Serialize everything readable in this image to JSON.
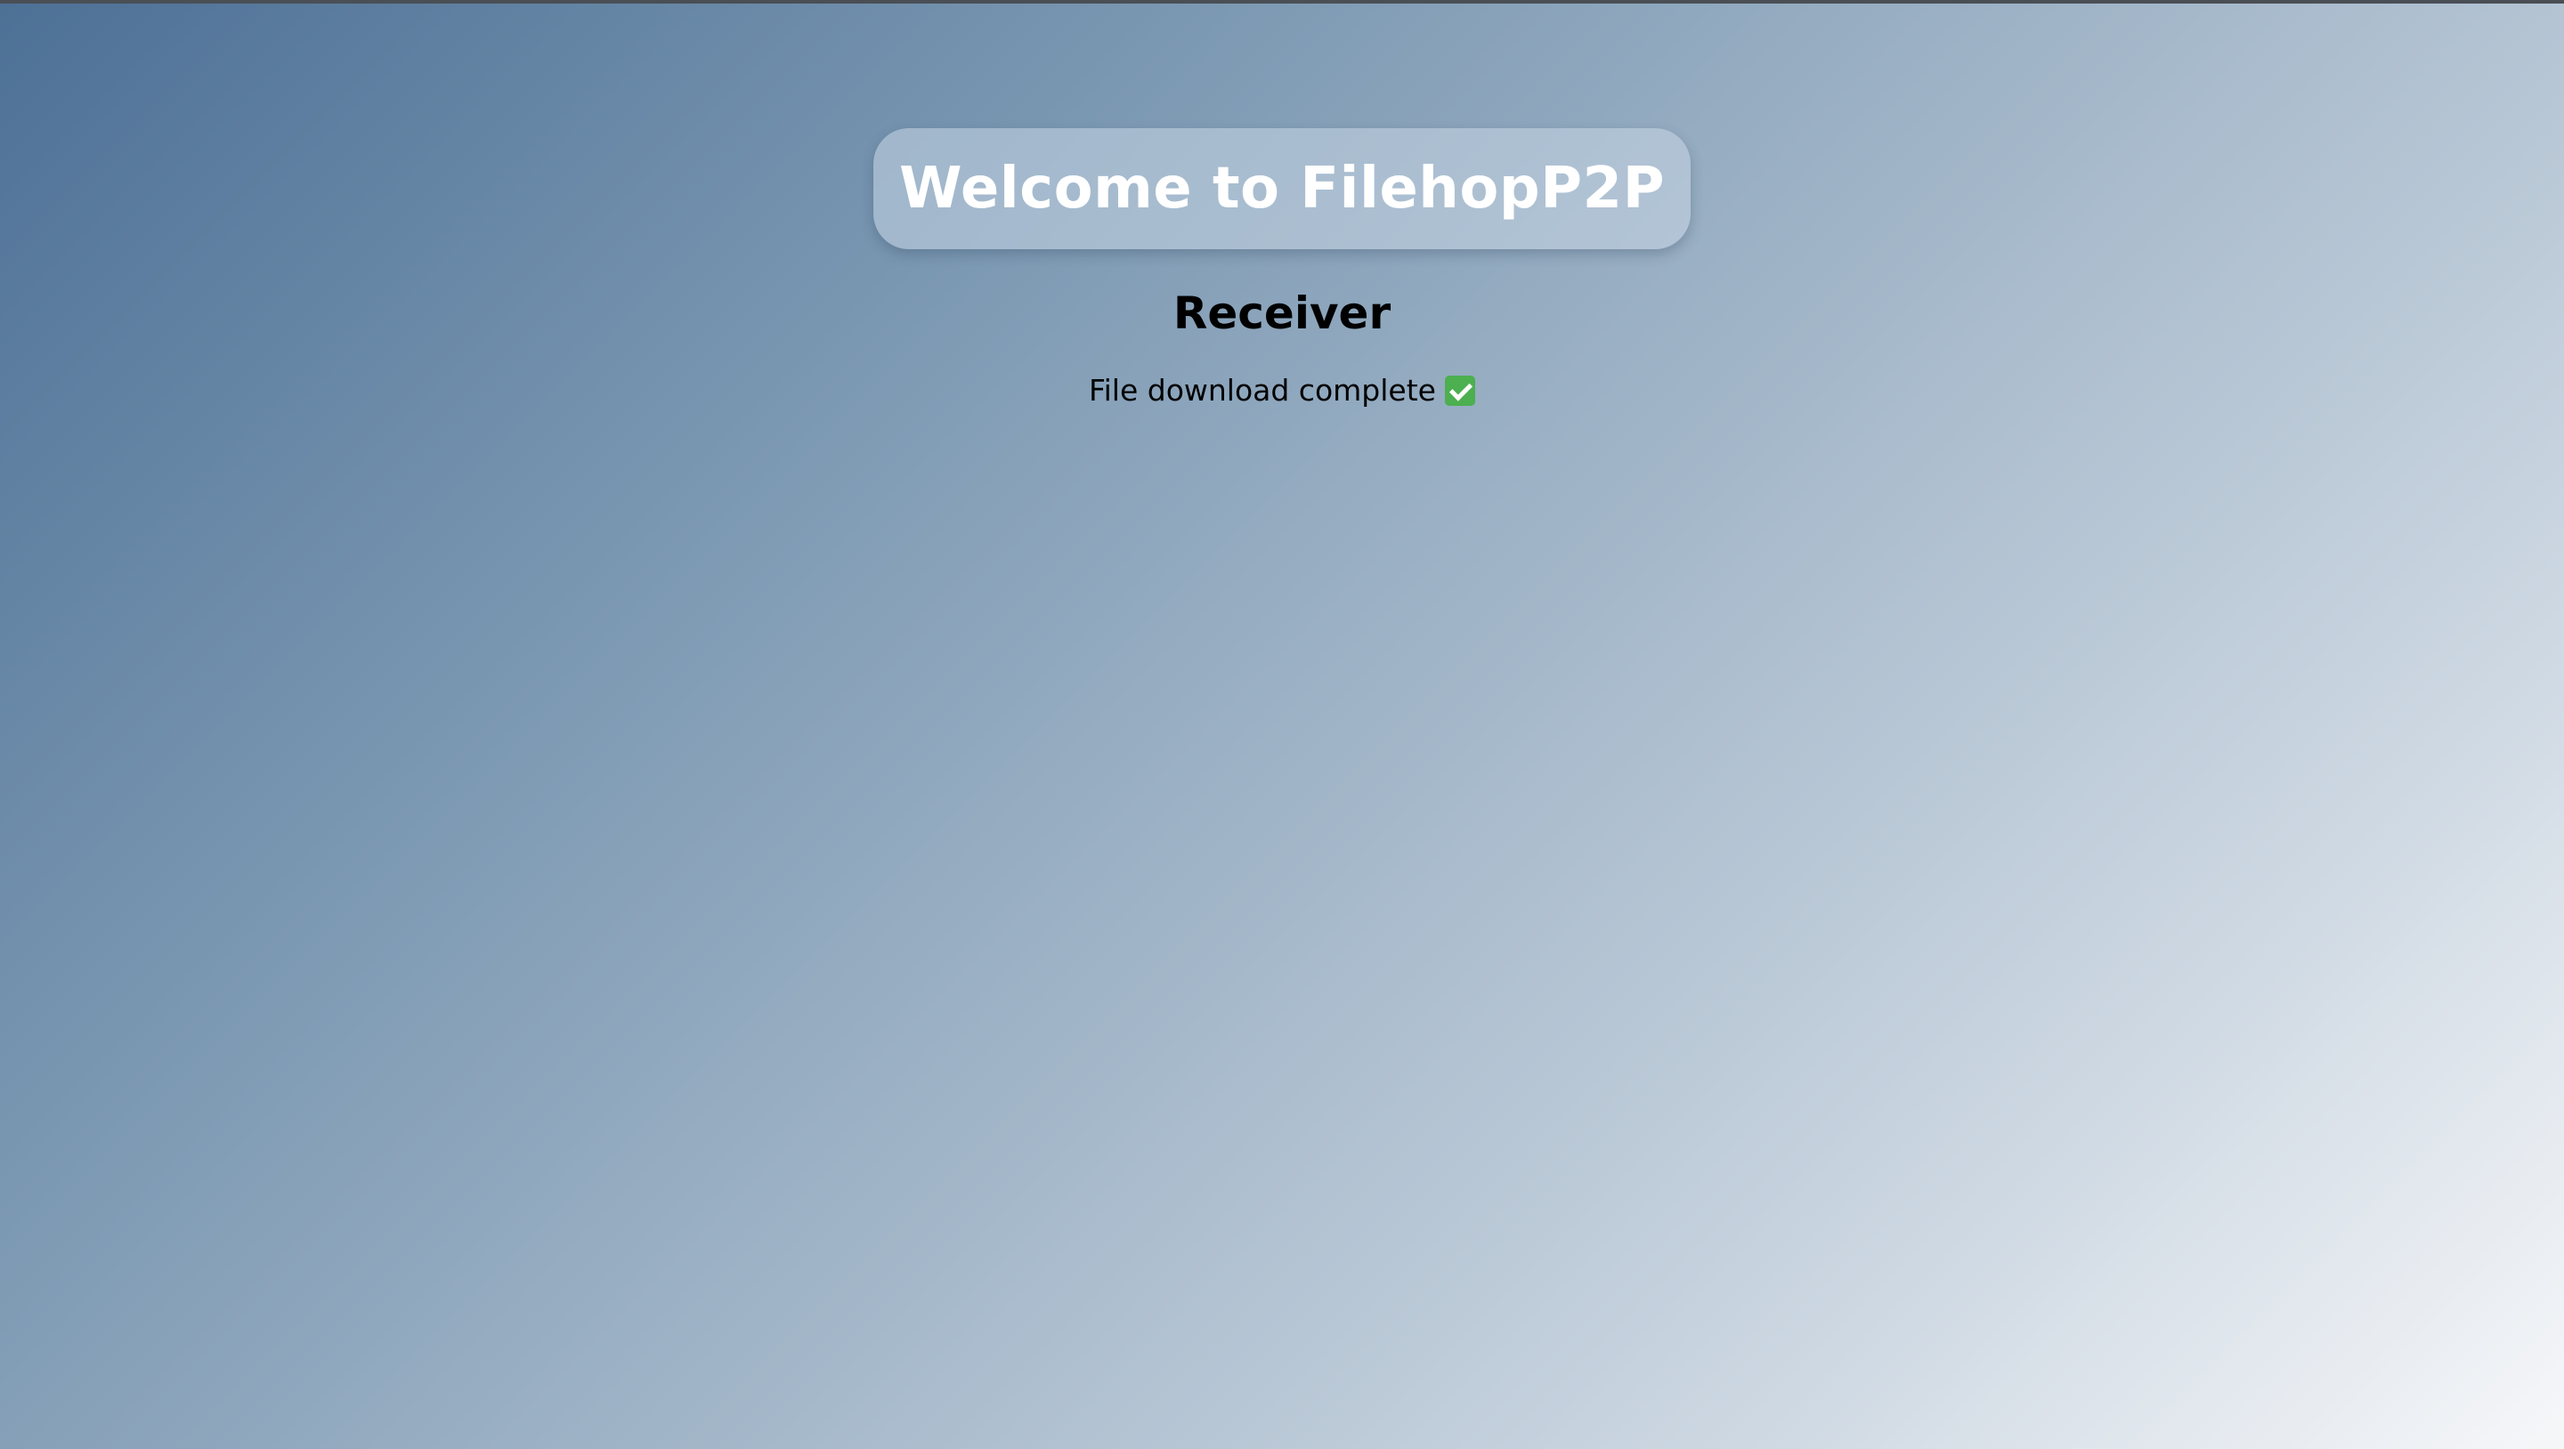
{
  "header": {
    "title": "Welcome to FilehopP2P"
  },
  "main": {
    "role_heading": "Receiver",
    "status_text": "File download complete",
    "status_icon": "check-mark-icon"
  },
  "colors": {
    "status_icon": "#4caf50",
    "title_text": "#ffffff"
  }
}
